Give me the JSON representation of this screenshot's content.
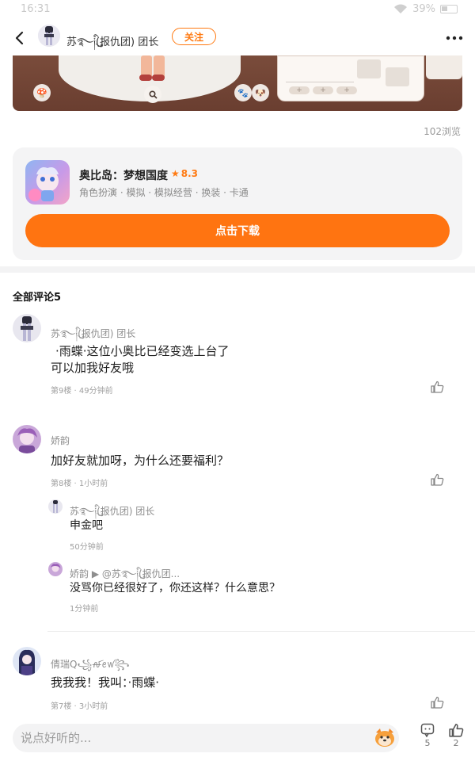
{
  "status_bar": {
    "time": "16:31",
    "battery": "39%"
  },
  "header": {
    "author_name": "苏࿐ི༏ུ(报仇团) 团长",
    "follow_label": "关注"
  },
  "post": {
    "view_count": "102浏览"
  },
  "game_card": {
    "title": "奥比岛：梦想国度",
    "rating": "8.3",
    "tags": "角色扮演 · 模拟 · 模拟经营 · 换装 · 卡通",
    "download_label": "点击下载"
  },
  "comments_section": {
    "header": "全部评论5",
    "comments": [
      {
        "name": "苏࿐ི༏ུ(报仇团) 团长",
        "lines": [
          "·雨蝶·这位小奥比已经变选上台了",
          "可以加我好友哦"
        ],
        "meta": "第9楼 · 49分钟前"
      },
      {
        "name": "娇韵",
        "lines": [
          "加好友就加呀，为什么还要福利？"
        ],
        "meta": "第8楼 · 1小时前",
        "replies": [
          {
            "name": "苏࿐ི༏ུ(报仇团) 团长",
            "text": "申金吧",
            "meta": "50分钟前"
          },
          {
            "name": "娇韵 ▶ @苏࿐ི༏ུ(报仇团...",
            "text": "没骂你已经很好了，你还这样？什么意思？",
            "meta": "1分钟前"
          }
        ]
      },
      {
        "name": "倩瑞Q꧁ꫛꫀꪝ꧂",
        "lines": [
          "我我我！我叫：·雨蝶·"
        ],
        "meta": "第7楼 · 3小时前"
      }
    ]
  },
  "bottom_bar": {
    "input_placeholder": "说点好听的...",
    "comment_count": "5",
    "like_count": "2"
  },
  "colors": {
    "accent": "#ff7411",
    "background": "#ffffff"
  }
}
